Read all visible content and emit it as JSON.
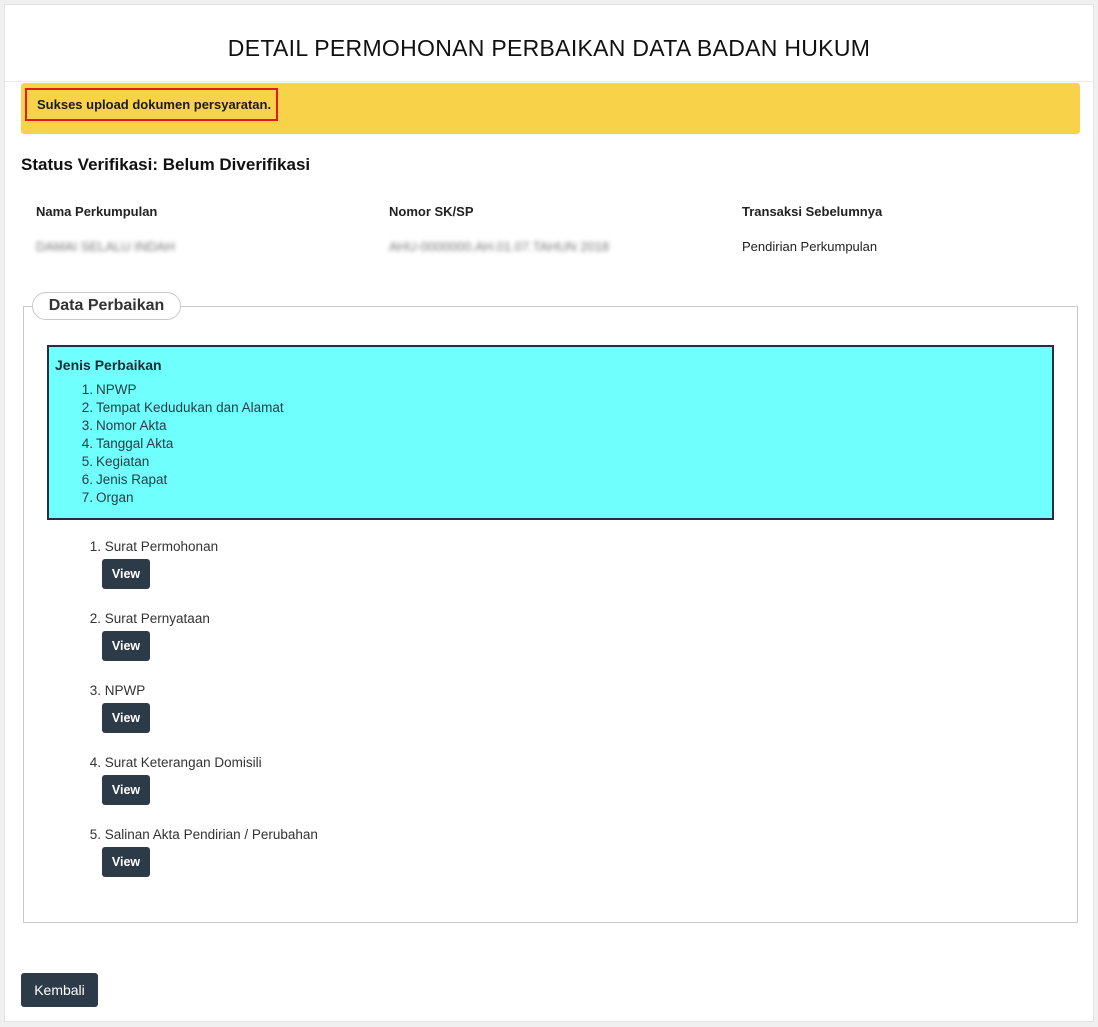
{
  "page": {
    "title": "DETAIL PERMOHONAN PERBAIKAN DATA BADAN HUKUM"
  },
  "alert": {
    "message": "Sukses upload dokumen persyaratan.",
    "color": "#f8d349",
    "highlight_color": "#e01b1b"
  },
  "status": {
    "text": "Status Verifikasi: Belum Diverifikasi"
  },
  "info": {
    "columns": [
      {
        "label": "Nama Perkumpulan",
        "value": "DAMAI SELALU INDAH",
        "blurred": true
      },
      {
        "label": "Nomor SK/SP",
        "value": "AHU-0000000.AH.01.07.TAHUN 2018",
        "blurred": true
      },
      {
        "label": "Transaksi Sebelumnya",
        "value": "Pendirian Perkumpulan",
        "blurred": false
      }
    ]
  },
  "data_perbaikan": {
    "legend": "Data Perbaikan",
    "jenis_title": "Jenis Perbaikan",
    "jenis_color": "#6ffffc",
    "jenis_items": [
      {
        "num": "1.",
        "text": "NPWP"
      },
      {
        "num": "2.",
        "text": "Tempat Kedudukan dan Alamat"
      },
      {
        "num": "3.",
        "text": "Nomor Akta"
      },
      {
        "num": "4.",
        "text": "Tanggal Akta"
      },
      {
        "num": "5.",
        "text": "Kegiatan"
      },
      {
        "num": "6.",
        "text": "Jenis Rapat"
      },
      {
        "num": "7.",
        "text": "Organ"
      }
    ],
    "documents": [
      {
        "num": "1.",
        "label": "Surat Permohonan",
        "button": "View"
      },
      {
        "num": "2.",
        "label": "Surat Pernyataan",
        "button": "View"
      },
      {
        "num": "3.",
        "label": "NPWP",
        "button": "View"
      },
      {
        "num": "4.",
        "label": "Surat Keterangan Domisili",
        "button": "View"
      },
      {
        "num": "5.",
        "label": "Salinan Akta Pendirian / Perubahan",
        "button": "View"
      }
    ]
  },
  "footer": {
    "back_label": "Kembali",
    "button_color": "#2d3a48"
  }
}
